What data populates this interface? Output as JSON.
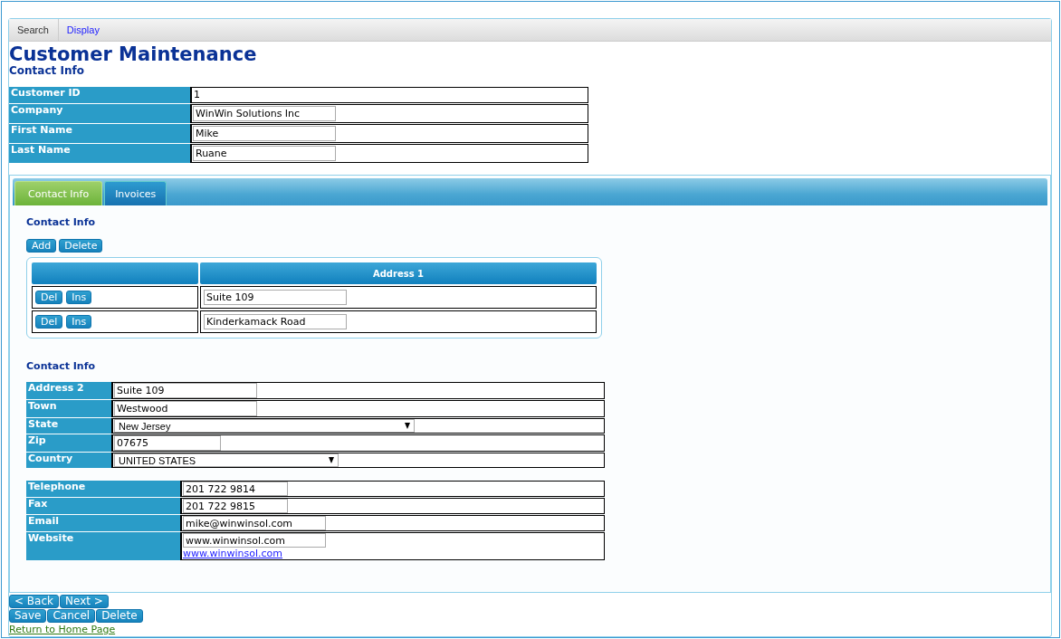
{
  "breadcrumb": [
    {
      "label": "Search",
      "kind": "current"
    },
    {
      "label": "Display",
      "kind": "link"
    }
  ],
  "title": "Customer Maintenance",
  "subtitle": "Contact Info",
  "header_fields": [
    {
      "label": "Customer ID",
      "kind": "static",
      "value": "1"
    },
    {
      "label": "Company",
      "kind": "text",
      "value": "WinWin Solutions Inc"
    },
    {
      "label": "First Name",
      "kind": "text",
      "value": "Mike"
    },
    {
      "label": "Last Name",
      "kind": "text",
      "value": "Ruane"
    }
  ],
  "tabs": [
    {
      "label": "Contact Info",
      "selected": true
    },
    {
      "label": "Invoices",
      "selected": false
    }
  ],
  "section_title": "Contact Info",
  "grid_buttons": [
    "Add",
    "Delete"
  ],
  "grid": {
    "columns": [
      "Address 1"
    ],
    "rows": [
      {
        "buttons": [
          "Del",
          "Ins"
        ],
        "value": "Suite 109"
      },
      {
        "buttons": [
          "Del",
          "Ins"
        ],
        "value": "Kinderkamack Road"
      }
    ]
  },
  "detail_title": "Contact Info",
  "address_fields": [
    {
      "label": "Address 2",
      "kind": "text",
      "value": "Suite 109"
    },
    {
      "label": "Town",
      "kind": "text",
      "value": "Westwood"
    },
    {
      "label": "State",
      "kind": "select",
      "value": "New Jersey"
    },
    {
      "label": "Zip",
      "kind": "text",
      "value": "07675"
    },
    {
      "label": "Country",
      "kind": "select",
      "value": "UNITED STATES"
    }
  ],
  "contact_fields": [
    {
      "label": "Telephone",
      "kind": "text",
      "value": "201 722 9814"
    },
    {
      "label": "Fax",
      "kind": "text",
      "value": "201 722 9815"
    },
    {
      "label": "Email",
      "kind": "text",
      "value": "mike@winwinsol.com"
    },
    {
      "label": "Website",
      "kind": "text",
      "value": "www.winwinsol.com",
      "link": "www.winwinsol.com"
    }
  ],
  "nav_buttons": [
    "< Back",
    "Next >"
  ],
  "action_buttons": [
    "Save",
    "Cancel",
    "Delete"
  ],
  "home_link": "Return to Home Page"
}
